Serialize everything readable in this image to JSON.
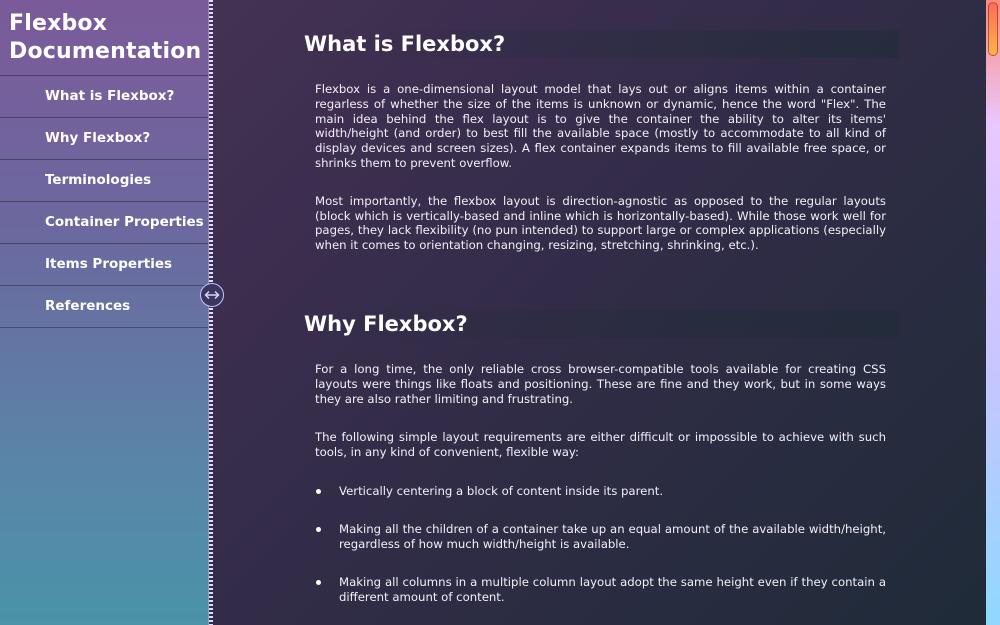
{
  "sidebar": {
    "title": "Flexbox Documentation",
    "items": [
      {
        "label": "What is Flexbox?"
      },
      {
        "label": "Why Flexbox?"
      },
      {
        "label": "Terminologies"
      },
      {
        "label": "Container Properties"
      },
      {
        "label": "Items Properties"
      },
      {
        "label": "References"
      }
    ]
  },
  "resizer": {
    "icon": "left-right-arrows-icon"
  },
  "main": {
    "sections": [
      {
        "heading": "What is Flexbox?",
        "paragraphs": [
          "Flexbox is a one-dimensional layout model that lays out or aligns items within a container regarless of whether the size of the items is unknown or dynamic, hence the word \"Flex\". The main idea behind the flex layout is to give the container the ability to alter its items' width/height (and order) to best fill the available space (mostly to accommodate to all kind of display devices and screen sizes). A flex container expands items to fill available free space, or shrinks them to prevent overflow.",
          "Most importantly, the flexbox layout is direction-agnostic as opposed to the regular layouts (block which is vertically-based and inline which is horizontally-based). While those work well for pages, they lack flexibility (no pun intended) to support large or complex applications (especially when it comes to orientation changing, resizing, stretching, shrinking, etc.)."
        ]
      },
      {
        "heading": "Why Flexbox?",
        "paragraphs": [
          "For a long time, the only reliable cross browser-compatible tools available for creating CSS layouts were things like floats and positioning. These are fine and they work, but in some ways they are also rather limiting and frustrating.",
          "The following simple layout requirements are either difficult or impossible to achieve with such tools, in any kind of convenient, flexible way:"
        ],
        "bullets": [
          "Vertically centering a block of content inside its parent.",
          "Making all the children of a container take up an equal amount of the available width/height, regardless of how much width/height is available.",
          "Making all columns in a multiple column layout adopt the same height even if they contain a different amount of content."
        ]
      }
    ]
  },
  "colors": {
    "sidebar_top": "#7b5a9a",
    "sidebar_bottom": "#4a93a8",
    "main_bg": "#3a2d4e",
    "scroll_thumb": "#ff6a5a"
  }
}
